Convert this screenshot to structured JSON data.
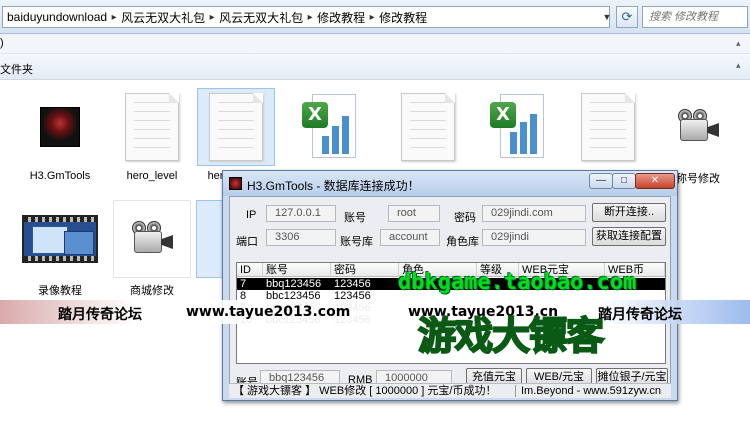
{
  "explorer": {
    "breadcrumb": [
      "baiduyundownload",
      "风云无双大礼包",
      "风云无双大礼包",
      "修改教程",
      "修改教程"
    ],
    "search_placeholder": "搜索 修改教程",
    "menu_fragment": ")",
    "toolbar_fragment": "文件夹",
    "files": [
      {
        "name": "H3.GmTools",
        "icon": "h3-app-icon"
      },
      {
        "name": "hero_level",
        "icon": "document-icon"
      },
      {
        "name": "hero_level1",
        "icon": "document-icon"
      },
      {
        "name": "",
        "icon": "excel-icon"
      },
      {
        "name": "",
        "icon": "document-icon"
      },
      {
        "name": "",
        "icon": "excel-icon"
      },
      {
        "name": "",
        "icon": "document-icon"
      },
      {
        "name": "称号修改",
        "icon": "camera-icon"
      },
      {
        "name": "录像教程",
        "icon": "video-icon"
      },
      {
        "name": "商城修改",
        "icon": "camera-icon"
      }
    ]
  },
  "gmtools": {
    "title": "H3.GmTools - 数据库连接成功！",
    "window_buttons": {
      "minimize": "—",
      "maximize": "□",
      "close": "✕"
    },
    "labels": {
      "ip": "IP",
      "account": "账号",
      "password": "密码",
      "port": "端口",
      "account_db": "账号库",
      "role_db": "角色库",
      "bottom_account": "账号",
      "rmb": "RMB"
    },
    "values": {
      "ip": "127.0.0.1",
      "account": "root",
      "password": "029jindi.com",
      "port": "3306",
      "account_db": "account",
      "role_db": "029jindi",
      "bottom_account": "bbq123456",
      "rmb": "1000000"
    },
    "buttons": {
      "disconnect": "断开连接..",
      "get_config": "获取连接配置",
      "recharge": "充值元宝",
      "web_yuanbao": "WEB/元宝",
      "stall_silver": "摊位银子/元宝"
    },
    "grid": {
      "columns": [
        "ID",
        "账号",
        "密码",
        "角色",
        "等级",
        "WEB元宝",
        "WEB币"
      ],
      "rows": [
        [
          "7",
          "bbq123456",
          "123456",
          "",
          "",
          "",
          ""
        ],
        [
          "8",
          "bbc123456",
          "123456",
          "",
          "",
          "",
          ""
        ],
        [
          "9",
          "bbq123456",
          "123456",
          "",
          "",
          "",
          ""
        ],
        [
          "10",
          "bbc123456",
          "123456",
          "",
          "",
          "",
          ""
        ]
      ],
      "selected_row": 0
    },
    "status": {
      "left": "【 游戏大镖客 】 WEB修改 [ 1000000 ] 元宝/币成功！",
      "right": "Im.Beyond - www.591zyw.cn"
    }
  },
  "overlay": {
    "banner_left": "踏月传奇论坛",
    "banner_url_1": "www.tayue2013.com",
    "banner_url_2": "www.tayue2013.cn",
    "banner_right": "踏月传奇论坛",
    "watermark_top": "dbkgame.taobao.com",
    "watermark_big": "游戏大镖客"
  },
  "colors": {
    "title_gradient_top": "#d9e7f8",
    "watermark_green": "#18d82a",
    "selection": "#000000"
  }
}
